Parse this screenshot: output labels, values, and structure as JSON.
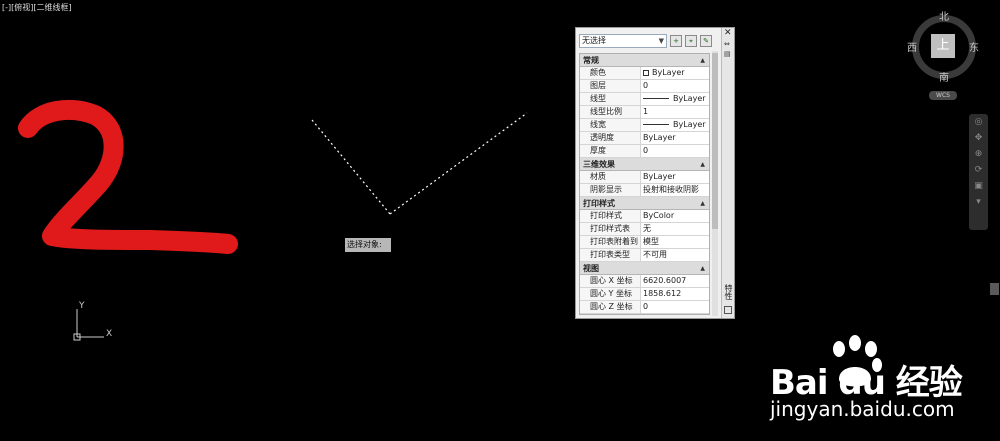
{
  "viewport": {
    "label": "[-][俯视][二维线框]",
    "prompt": "选择对象:",
    "ucs": {
      "x_label": "X",
      "y_label": "Y"
    }
  },
  "viewcube": {
    "north": "北",
    "south": "南",
    "west": "西",
    "east": "东",
    "face": "上",
    "wcs": "WCS"
  },
  "properties": {
    "title": "特性",
    "selection": "无选择",
    "sections": [
      {
        "title": "常规",
        "rows": [
          {
            "key": "颜色",
            "value": "ByLayer",
            "swatch": "square"
          },
          {
            "key": "图层",
            "value": "0"
          },
          {
            "key": "线型",
            "value": "ByLayer",
            "swatch": "line"
          },
          {
            "key": "线型比例",
            "value": "1"
          },
          {
            "key": "线宽",
            "value": "ByLayer",
            "swatch": "line"
          },
          {
            "key": "透明度",
            "value": "ByLayer"
          },
          {
            "key": "厚度",
            "value": "0"
          }
        ]
      },
      {
        "title": "三维效果",
        "rows": [
          {
            "key": "材质",
            "value": "ByLayer"
          },
          {
            "key": "阴影显示",
            "value": "投射和接收阴影"
          }
        ]
      },
      {
        "title": "打印样式",
        "rows": [
          {
            "key": "打印样式",
            "value": "ByColor"
          },
          {
            "key": "打印样式表",
            "value": "无"
          },
          {
            "key": "打印表附着到",
            "value": "模型"
          },
          {
            "key": "打印表类型",
            "value": "不可用"
          }
        ]
      },
      {
        "title": "视图",
        "rows": [
          {
            "key": "圆心 X 坐标",
            "value": "6620.6007"
          },
          {
            "key": "圆心 Y 坐标",
            "value": "1858.612"
          },
          {
            "key": "圆心 Z 坐标",
            "value": "0"
          }
        ]
      }
    ]
  },
  "watermark": {
    "logo": "Bai du 经验",
    "url": "jingyan.baidu.com"
  },
  "colors": {
    "annotation": "#e01a1a",
    "background": "#000000",
    "dashed_line": "#ffffff"
  }
}
